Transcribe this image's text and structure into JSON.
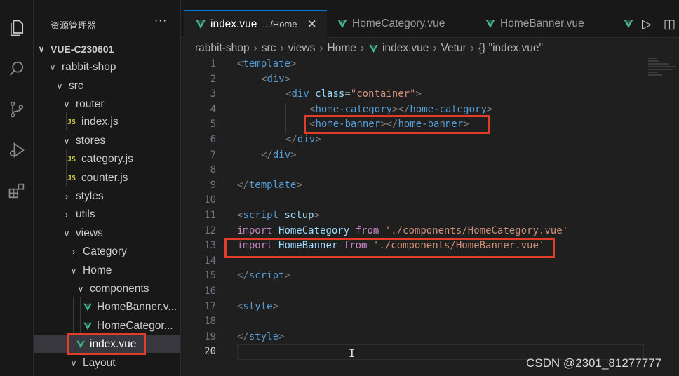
{
  "colors": {
    "accent": "#0078d4",
    "vue_green": "#41b883",
    "highlight_box": "#e23c2b"
  },
  "activity_bar": [
    "files-icon",
    "search-icon",
    "source-control-icon",
    "run-debug-icon",
    "extensions-icon"
  ],
  "sidebar": {
    "title": "资源管理器",
    "more": "···",
    "tree": [
      {
        "label": "VUE-C230601",
        "kind": "root"
      },
      {
        "label": "rabbit-shop",
        "kind": "folder-open"
      },
      {
        "label": "src",
        "kind": "folder-open"
      },
      {
        "label": "router",
        "kind": "folder-open"
      },
      {
        "label": "index.js",
        "kind": "js"
      },
      {
        "label": "stores",
        "kind": "folder-open"
      },
      {
        "label": "category.js",
        "kind": "js"
      },
      {
        "label": "counter.js",
        "kind": "js"
      },
      {
        "label": "styles",
        "kind": "folder-closed"
      },
      {
        "label": "utils",
        "kind": "folder-closed"
      },
      {
        "label": "views",
        "kind": "folder-open"
      },
      {
        "label": "Category",
        "kind": "folder-closed"
      },
      {
        "label": "Home",
        "kind": "folder-open"
      },
      {
        "label": "components",
        "kind": "folder-open"
      },
      {
        "label": "HomeBanner.v...",
        "kind": "vue"
      },
      {
        "label": "HomeCategor...",
        "kind": "vue"
      },
      {
        "label": "index.vue",
        "kind": "vue"
      },
      {
        "label": "Layout",
        "kind": "folder-open"
      }
    ],
    "js_badge": "JS"
  },
  "tabs": [
    {
      "label": "index.vue",
      "path": ".../Home",
      "close": "✕"
    },
    {
      "label": "HomeCategory.vue"
    },
    {
      "label": "HomeBanner.vue"
    }
  ],
  "tab_tools": {
    "run": "▷",
    "split": "◫"
  },
  "breadcrumb": [
    "rabbit-shop",
    "src",
    "views",
    "Home",
    "index.vue",
    "Vetur",
    "{} \"index.vue\""
  ],
  "breadcrumb_sep": "›",
  "line_numbers": [
    "1",
    "2",
    "3",
    "4",
    "5",
    "6",
    "7",
    "8",
    "9",
    "10",
    "11",
    "12",
    "13",
    "14",
    "15",
    "16",
    "17",
    "18",
    "19",
    "20"
  ],
  "code": {
    "l1_open": "<",
    "l1_tag": "template",
    "l1_close": ">",
    "l2_open": "<",
    "l2_tag": "div",
    "l2_close": ">",
    "l3_open": "<",
    "l3_tag": "div",
    "l3_attr": "class",
    "l3_eq": "=",
    "l3_val": "\"container\"",
    "l3_close": ">",
    "l4_open": "<",
    "l4_tag": "home-category",
    "l4_mid": "></",
    "l4_tag2": "home-category",
    "l4_close": ">",
    "l5_open": "<",
    "l5_tag": "home-banner",
    "l5_mid": "></",
    "l5_tag2": "home-banner",
    "l5_close": ">",
    "l6_open": "</",
    "l6_tag": "div",
    "l6_close": ">",
    "l7_open": "</",
    "l7_tag": "div",
    "l7_close": ">",
    "l9_open": "</",
    "l9_tag": "template",
    "l9_close": ">",
    "l11_open": "<",
    "l11_tag": "script",
    "l11_attr": "setup",
    "l11_close": ">",
    "l12_kw": "import",
    "l12_id": "HomeCategory",
    "l12_from": "from",
    "l12_str": "'./components/HomeCategory.vue'",
    "l13_kw": "import",
    "l13_id": "HomeBanner",
    "l13_from": "from",
    "l13_str": "'./components/HomeBanner.vue'",
    "l15_open": "</",
    "l15_tag": "script",
    "l15_close": ">",
    "l17_open": "<",
    "l17_tag": "style",
    "l17_close": ">",
    "l19_open": "</",
    "l19_tag": "style",
    "l19_close": ">"
  },
  "watermark": "CSDN @2301_81277777",
  "ibeam": "I"
}
